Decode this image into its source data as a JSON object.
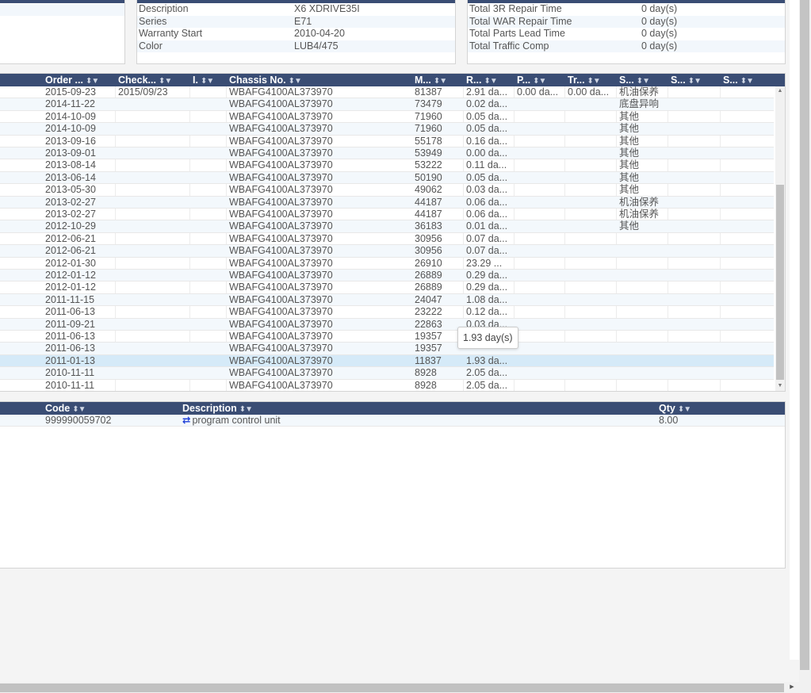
{
  "vehicle_info": {
    "rows": [
      {
        "label": "Description",
        "value": "X6 XDRIVE35I"
      },
      {
        "label": "Series",
        "value": "E71"
      },
      {
        "label": "Warranty Start",
        "value": "2010-04-20"
      },
      {
        "label": "Color",
        "value": "LUB4/475"
      }
    ]
  },
  "repair_summary": {
    "rows": [
      {
        "label": "Total 3R Repair Time",
        "value": "0 day(s)"
      },
      {
        "label": "Total WAR Repair Time",
        "value": "0 day(s)"
      },
      {
        "label": "Total Parts Lead Time",
        "value": "0 day(s)"
      },
      {
        "label": "Total Traffic Comp",
        "value": "0 day(s)"
      }
    ]
  },
  "orders_grid": {
    "columns": [
      "Order ...",
      "Check...",
      "I.",
      "Chassis No.",
      "M...",
      "R...",
      "P...",
      "Tr...",
      "S...",
      "S...",
      "S..."
    ],
    "rows": [
      [
        "2015-09-23",
        "2015/09/23",
        "",
        "WBAFG4100AL373970",
        "81387",
        "2.91 da...",
        "0.00 da...",
        "0.00 da...",
        "机油保养",
        "",
        ""
      ],
      [
        "2014-11-22",
        "",
        "",
        "WBAFG4100AL373970",
        "73479",
        "0.02 da...",
        "",
        "",
        "底盘异响",
        "",
        ""
      ],
      [
        "2014-10-09",
        "",
        "",
        "WBAFG4100AL373970",
        "71960",
        "0.05 da...",
        "",
        "",
        "其他",
        "",
        ""
      ],
      [
        "2014-10-09",
        "",
        "",
        "WBAFG4100AL373970",
        "71960",
        "0.05 da...",
        "",
        "",
        "其他",
        "",
        ""
      ],
      [
        "2013-09-16",
        "",
        "",
        "WBAFG4100AL373970",
        "55178",
        "0.16 da...",
        "",
        "",
        "其他",
        "",
        ""
      ],
      [
        "2013-09-01",
        "",
        "",
        "WBAFG4100AL373970",
        "53949",
        "0.00 da...",
        "",
        "",
        "其他",
        "",
        ""
      ],
      [
        "2013-08-14",
        "",
        "",
        "WBAFG4100AL373970",
        "53222",
        "0.11 da...",
        "",
        "",
        "其他",
        "",
        ""
      ],
      [
        "2013-06-14",
        "",
        "",
        "WBAFG4100AL373970",
        "50190",
        "0.05 da...",
        "",
        "",
        "其他",
        "",
        ""
      ],
      [
        "2013-05-30",
        "",
        "",
        "WBAFG4100AL373970",
        "49062",
        "0.03 da...",
        "",
        "",
        "其他",
        "",
        ""
      ],
      [
        "2013-02-27",
        "",
        "",
        "WBAFG4100AL373970",
        "44187",
        "0.06 da...",
        "",
        "",
        "机油保养",
        "",
        ""
      ],
      [
        "2013-02-27",
        "",
        "",
        "WBAFG4100AL373970",
        "44187",
        "0.06 da...",
        "",
        "",
        "机油保养",
        "",
        ""
      ],
      [
        "2012-10-29",
        "",
        "",
        "WBAFG4100AL373970",
        "36183",
        "0.01 da...",
        "",
        "",
        "其他",
        "",
        ""
      ],
      [
        "2012-06-21",
        "",
        "",
        "WBAFG4100AL373970",
        "30956",
        "0.07 da...",
        "",
        "",
        "",
        "",
        ""
      ],
      [
        "2012-06-21",
        "",
        "",
        "WBAFG4100AL373970",
        "30956",
        "0.07 da...",
        "",
        "",
        "",
        "",
        ""
      ],
      [
        "2012-01-30",
        "",
        "",
        "WBAFG4100AL373970",
        "26910",
        "23.29 ...",
        "",
        "",
        "",
        "",
        ""
      ],
      [
        "2012-01-12",
        "",
        "",
        "WBAFG4100AL373970",
        "26889",
        "0.29 da...",
        "",
        "",
        "",
        "",
        ""
      ],
      [
        "2012-01-12",
        "",
        "",
        "WBAFG4100AL373970",
        "26889",
        "0.29 da...",
        "",
        "",
        "",
        "",
        ""
      ],
      [
        "2011-11-15",
        "",
        "",
        "WBAFG4100AL373970",
        "24047",
        "1.08 da...",
        "",
        "",
        "",
        "",
        ""
      ],
      [
        "2011-06-13",
        "",
        "",
        "WBAFG4100AL373970",
        "23222",
        "0.12 da...",
        "",
        "",
        "",
        "",
        ""
      ],
      [
        "2011-09-21",
        "",
        "",
        "WBAFG4100AL373970",
        "22863",
        "0.03 da...",
        "",
        "",
        "",
        "",
        ""
      ],
      [
        "2011-06-13",
        "",
        "",
        "WBAFG4100AL373970",
        "19357",
        "",
        "",
        "",
        "",
        "",
        ""
      ],
      [
        "2011-06-13",
        "",
        "",
        "WBAFG4100AL373970",
        "19357",
        "",
        "",
        "",
        "",
        "",
        ""
      ],
      [
        "2011-01-13",
        "",
        "",
        "WBAFG4100AL373970",
        "11837",
        "1.93 da...",
        "",
        "",
        "",
        "",
        ""
      ],
      [
        "2010-11-11",
        "",
        "",
        "WBAFG4100AL373970",
        "8928",
        "2.05 da...",
        "",
        "",
        "",
        "",
        ""
      ],
      [
        "2010-11-11",
        "",
        "",
        "WBAFG4100AL373970",
        "8928",
        "2.05 da...",
        "",
        "",
        "",
        "",
        ""
      ]
    ],
    "tooltip": "1.93 day(s)"
  },
  "parts_grid": {
    "columns": [
      "Code",
      "Description",
      "Qty"
    ],
    "rows": [
      [
        "999990059702",
        "program control unit",
        "8.00"
      ]
    ]
  }
}
